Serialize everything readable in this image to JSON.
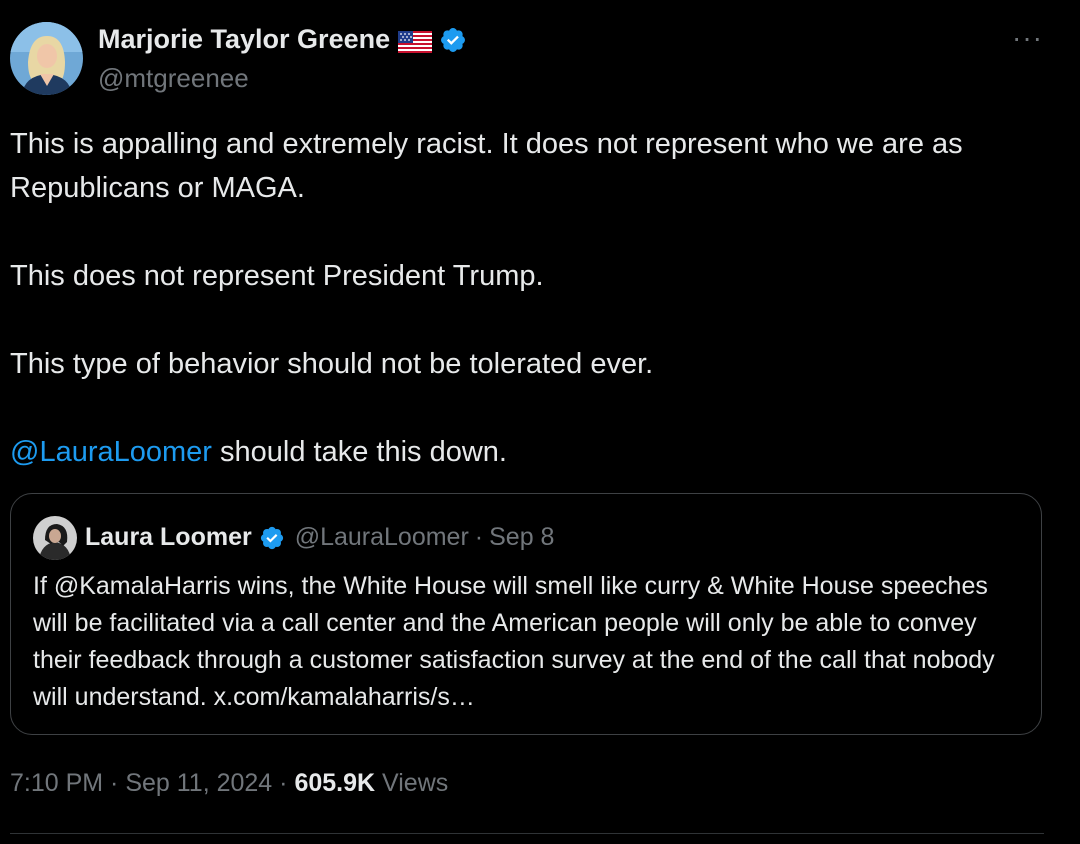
{
  "author": {
    "display_name": "Marjorie Taylor Greene",
    "handle": "@mtgreenee",
    "flag_emoji": "us-flag-icon",
    "verified": true
  },
  "more_menu": "···",
  "body": {
    "para1": "This is appalling and extremely racist.  It does not represent who we are as Republicans or MAGA.",
    "para2": "This does not represent President Trump.",
    "para3": "This type of behavior should not be tolerated ever.",
    "para4_mention": "@LauraLoomer",
    "para4_rest": " should take this down."
  },
  "quoted": {
    "display_name": "Laura Loomer",
    "handle": "@LauraLoomer",
    "separator": "·",
    "date": "Sep 8",
    "text": "If @KamalaHarris wins, the White House will smell like curry & White House speeches will be facilitated via a call center and the American people will only be able to convey their feedback through a customer satisfaction survey at the end of the call that nobody will understand. x.com/kamalaharris/s…"
  },
  "meta": {
    "time": "7:10 PM",
    "sep1": " · ",
    "date": "Sep 11, 2024",
    "sep2": " · ",
    "views_count": "605.9K",
    "views_label": " Views"
  },
  "colors": {
    "background": "#000000",
    "text": "#e7e9ea",
    "muted": "#71767b",
    "accent": "#1d9bf0",
    "border": "#3e4144"
  }
}
